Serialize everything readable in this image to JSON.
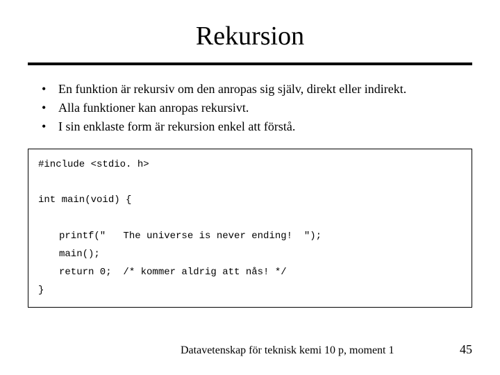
{
  "title": "Rekursion",
  "bullets": [
    "En funktion är rekursiv om den anropas sig själv, direkt eller indirekt.",
    "Alla funktioner kan anropas rekursivt.",
    "I sin enklaste form är rekursion enkel att förstå."
  ],
  "code": {
    "l1": "#include <stdio. h>",
    "l2": "int main(void) {",
    "l3": "printf(\"   The universe is never ending!  \");",
    "l4": "main();",
    "l5": "return 0;  /* kommer aldrig att nås! */",
    "l6": "}"
  },
  "footer": {
    "text": "Datavetenskap för teknisk kemi 10 p, moment 1",
    "page": "45"
  }
}
